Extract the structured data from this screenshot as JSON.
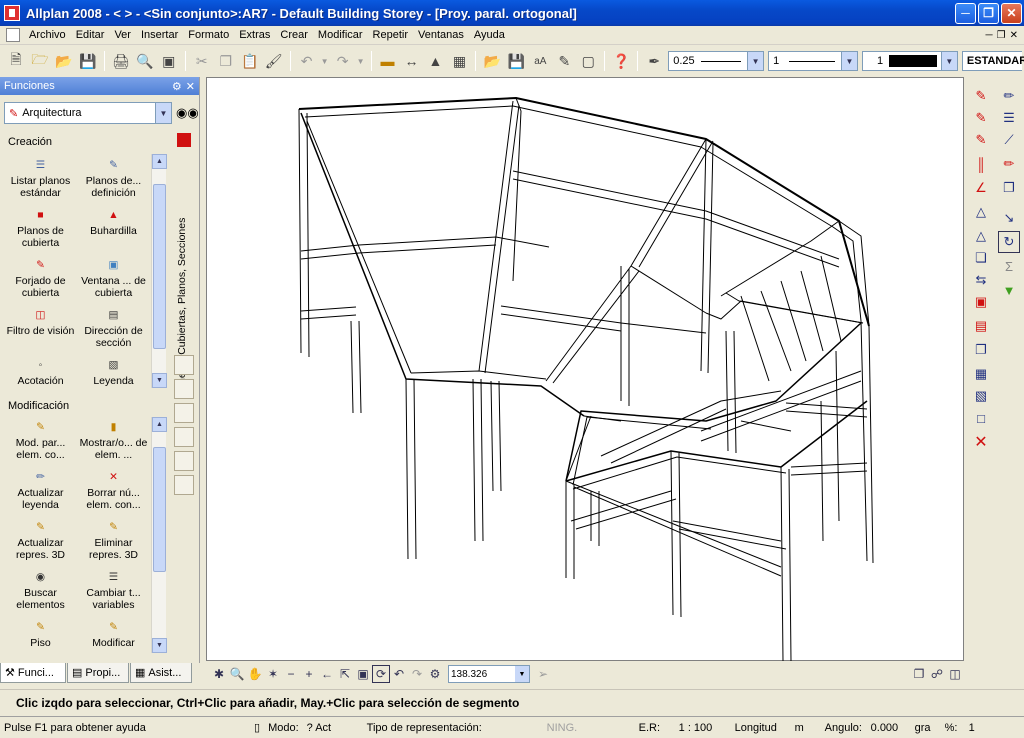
{
  "window": {
    "title": "Allplan 2008 - <      > - <Sin conjunto>:AR7 - Default Building Storey - [Proy. paral. ortogonal]"
  },
  "menu": [
    "Archivo",
    "Editar",
    "Ver",
    "Insertar",
    "Formato",
    "Extras",
    "Crear",
    "Modificar",
    "Repetir",
    "Ventanas",
    "Ayuda"
  ],
  "toolbar": {
    "pen_value": "0.25",
    "line_value": "1",
    "color_value": "1",
    "layer_value": "ESTANDAR"
  },
  "functions_panel": {
    "title": "Funciones",
    "module": "Arquitectura",
    "creation_label": "Creación",
    "creation_items": [
      {
        "label": "Listar planos estándar",
        "icon": "list-planes-icon"
      },
      {
        "label": "Planos de... definición",
        "icon": "plane-definition-icon"
      },
      {
        "label": "Planos de cubierta",
        "icon": "roof-planes-icon"
      },
      {
        "label": "Buhardilla",
        "icon": "dormer-icon"
      },
      {
        "label": "Forjado de cubierta",
        "icon": "roof-slab-icon"
      },
      {
        "label": "Ventana ... de cubierta",
        "icon": "roof-window-icon"
      },
      {
        "label": "Filtro de visión",
        "icon": "view-filter-icon"
      },
      {
        "label": "Dirección de sección",
        "icon": "section-direction-icon"
      },
      {
        "label": "Acotación",
        "icon": "dimension-icon"
      },
      {
        "label": "Leyenda",
        "icon": "legend-icon"
      }
    ],
    "modification_label": "Modificación",
    "modification_items": [
      {
        "label": "Mod. par... elem. co...",
        "icon": "modify-params-icon"
      },
      {
        "label": "Mostrar/o... de elem. ...",
        "icon": "show-hide-icon"
      },
      {
        "label": "Actualizar leyenda",
        "icon": "update-legend-icon"
      },
      {
        "label": "Borrar nú... elem. con...",
        "icon": "delete-number-icon"
      },
      {
        "label": "Actualizar repres. 3D",
        "icon": "update-3d-icon"
      },
      {
        "label": "Eliminar repres. 3D",
        "icon": "delete-3d-icon"
      },
      {
        "label": "Buscar elementos",
        "icon": "find-elements-icon"
      },
      {
        "label": "Cambiar t... variables",
        "icon": "change-variables-icon"
      },
      {
        "label": "Piso",
        "icon": "floor-icon"
      },
      {
        "label": "Modificar",
        "icon": "modify-icon"
      }
    ],
    "vertical_tab": "General: Cubiertas, Planos, Secciones"
  },
  "bottom_tabs": [
    {
      "label": "Funci...",
      "active": true
    },
    {
      "label": "Propi...",
      "active": false
    },
    {
      "label": "Asist...",
      "active": false
    }
  ],
  "view": {
    "zoom_value": "138.326"
  },
  "prompt": "Clic izqdo para seleccionar, Ctrl+Clic para añadir, May.+Clic para selección de segmento",
  "status": {
    "help": "Pulse F1 para obtener ayuda",
    "mode_label": "Modo:",
    "mode_value": "? Act",
    "repr_label": "Tipo de representación:",
    "repr_value": "NING.",
    "scale_label": "E.R:",
    "scale_value": "1 : 100",
    "length_label": "Longitud",
    "length_unit": "m",
    "angle_label": "Angulo:",
    "angle_value": "0.000",
    "angle_unit": "gra",
    "percent_label": "%:",
    "percent_value": "1"
  },
  "colors": {
    "titlebar": "#0648c8",
    "accent_red": "#d01010"
  }
}
